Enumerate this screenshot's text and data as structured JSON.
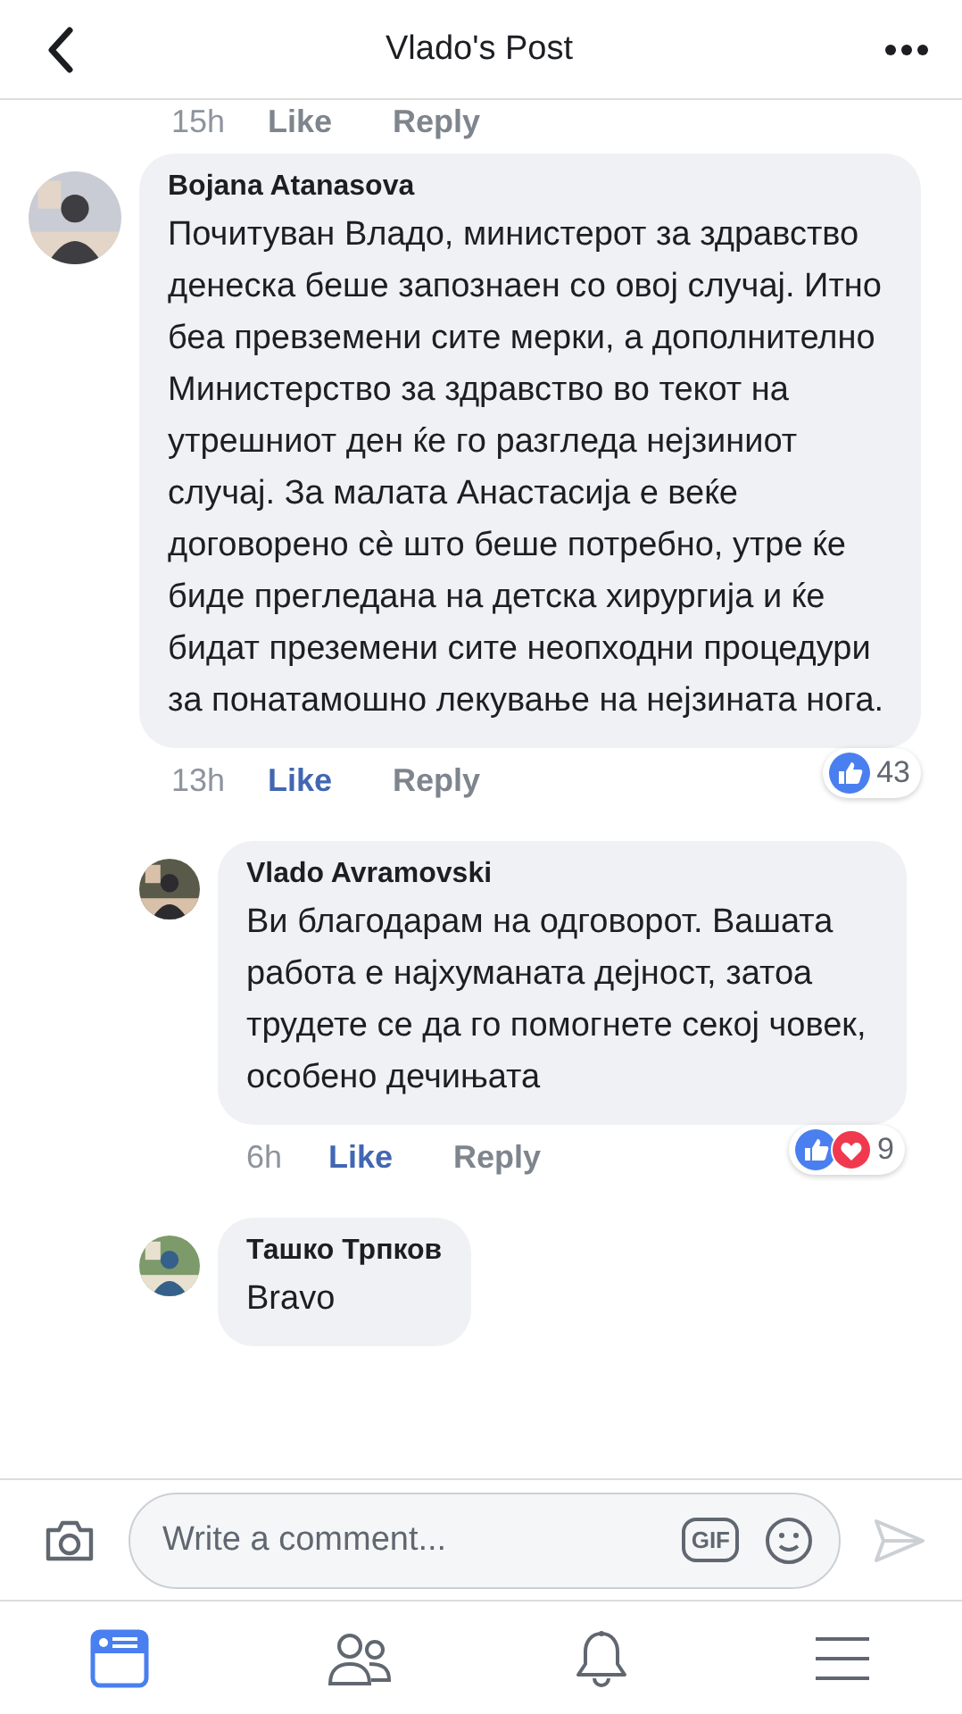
{
  "header": {
    "title": "Vlado's Post"
  },
  "previous_actions": {
    "time": "15h",
    "like": "Like",
    "reply": "Reply"
  },
  "comments": [
    {
      "author": "Bojana Atanasova",
      "reply": false,
      "text": "Почитуван Владо, министерот за здравство денеска беше запознаен со овој случај. Итно беа превземени сите мерки, а дополнително Министерство за здравство во текот на утрешниот ден ќе го разгледа нејзиниот случај. За малата Анастасија е веќе договорено сѐ што беше потребно, утре ќе биде прегледана на детска хирургија и ќе бидат преземени сите неопходни процедури за понатамошно лекување на нејзината нога.",
      "time": "13h",
      "like": "Like",
      "reply_label": "Reply",
      "reactions": [
        {
          "kind": "like"
        }
      ],
      "reaction_count": "43"
    },
    {
      "author": "Vlado Avramovski",
      "reply": true,
      "text": "Ви благодарам на одговорот. Вашата работа е најхуманата дејност, затоа трудете се да го помогнете секој човек, особено дечињата",
      "time": "6h",
      "like": "Like",
      "reply_label": "Reply",
      "reactions": [
        {
          "kind": "like"
        },
        {
          "kind": "love"
        }
      ],
      "reaction_count": "9"
    },
    {
      "author": "Ташко Трпков",
      "reply": true,
      "text": "Bravo"
    }
  ],
  "composer": {
    "placeholder": "Write a comment...",
    "gif": "GIF"
  },
  "tabs": [
    {
      "kind": "feed",
      "selected": true
    },
    {
      "kind": "friends",
      "selected": false
    },
    {
      "kind": "notifications",
      "selected": false
    },
    {
      "kind": "menu",
      "selected": false
    }
  ]
}
